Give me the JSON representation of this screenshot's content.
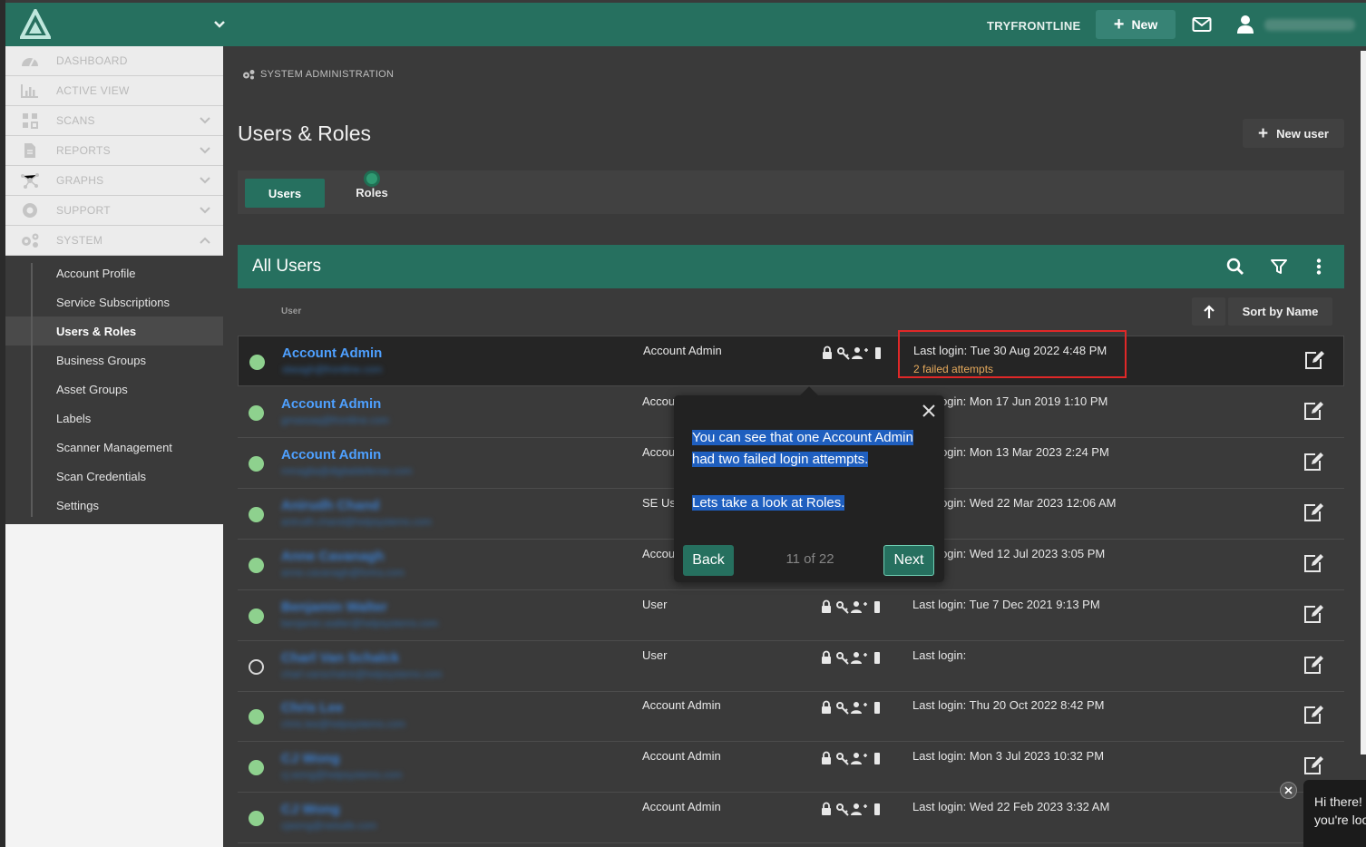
{
  "topbar": {
    "account_name": "TRYFRONTLINE",
    "new_button": "New",
    "user_name": "Anne Cavanagh"
  },
  "sidebar": {
    "items": [
      {
        "label": "DASHBOARD",
        "icon": "dashboard-gauge-icon"
      },
      {
        "label": "ACTIVE VIEW",
        "icon": "bar-chart-icon"
      },
      {
        "label": "SCANS",
        "icon": "scans-icon",
        "expandable": true
      },
      {
        "label": "REPORTS",
        "icon": "document-icon",
        "expandable": true
      },
      {
        "label": "GRAPHS",
        "icon": "network-icon",
        "expandable": true
      },
      {
        "label": "SUPPORT",
        "icon": "lifebuoy-icon",
        "expandable": true
      },
      {
        "label": "SYSTEM",
        "icon": "gears-icon",
        "expanded": true
      }
    ],
    "system_submenu": [
      "Account Profile",
      "Service Subscriptions",
      "Users & Roles",
      "Business Groups",
      "Asset Groups",
      "Labels",
      "Scanner Management",
      "Scan Credentials",
      "Settings"
    ],
    "active_submenu": "Users & Roles"
  },
  "main": {
    "breadcrumb": "SYSTEM ADMINISTRATION",
    "title": "Users & Roles",
    "new_user_button": "New user",
    "tabs": [
      "Users",
      "Roles"
    ],
    "list_title": "All Users",
    "column_user": "User",
    "sort_label": "Sort by Name"
  },
  "users": [
    {
      "name": "Account Admin",
      "email": "sbeagh@frontline.com",
      "role": "Account Admin",
      "login": "Last login: Tue 30 Aug 2022 4:48 PM",
      "failed": "2 failed attempts",
      "active": true,
      "clear": true
    },
    {
      "name": "Account Admin",
      "email": "gmassaq@frontline.com",
      "role": "Account Admin",
      "login": "Last login: Mon 17 Jun 2019 1:10 PM",
      "active": true,
      "clear": true
    },
    {
      "name": "Account Admin",
      "email": "mmaglia@digitaldefense.com",
      "role": "Account Admin",
      "login": "Last login: Mon 13 Mar 2023 2:24 PM",
      "active": true,
      "clear": true
    },
    {
      "name": "Anirudh Chand",
      "email": "anirudh.chand@helpsystems.com",
      "role": "SE User",
      "login": "Last login: Wed 22 Mar 2023 12:06 AM",
      "active": true
    },
    {
      "name": "Anne Cavanagh",
      "email": "anne.cavanagh@fortra.com",
      "role": "Account Admin",
      "login": "Last login: Wed 12 Jul 2023 3:05 PM",
      "active": true
    },
    {
      "name": "Benjamin Walter",
      "email": "benjamin.walter@helpsystems.com",
      "role": "User",
      "login": "Last login: Tue 7 Dec 2021 9:13 PM",
      "active": true
    },
    {
      "name": "Charl Van Schalck",
      "email": "charl.vanschalck@helpsystems.com",
      "role": "User",
      "login": "Last login:",
      "active": false
    },
    {
      "name": "Chris Lee",
      "email": "chris.lee@helpsystems.com",
      "role": "Account Admin",
      "login": "Last login: Thu 20 Oct 2022 8:42 PM",
      "active": true
    },
    {
      "name": "CJ Wong",
      "email": "cj.wong@helpsystems.com",
      "role": "Account Admin",
      "login": "Last login: Mon 3 Jul 2023 10:32 PM",
      "active": true
    },
    {
      "name": "CJ Wong",
      "email": "cjwong@netsafe.com",
      "role": "Account Admin",
      "login": "Last login: Wed 22 Feb 2023 3:32 AM",
      "active": true
    }
  ],
  "tour": {
    "line1": "You can see that one Account Admin",
    "line2": "had two failed login attempts.",
    "line3": "Lets take a look at Roles.",
    "back": "Back",
    "progress": "11 of 22",
    "next": "Next"
  },
  "chat": {
    "line1": "Hi there!",
    "line2": "you're loo"
  },
  "colors": {
    "accent": "#26705f",
    "link": "#4ea0ff",
    "warning": "#e5a95c",
    "highlight_box": "#e02828"
  }
}
